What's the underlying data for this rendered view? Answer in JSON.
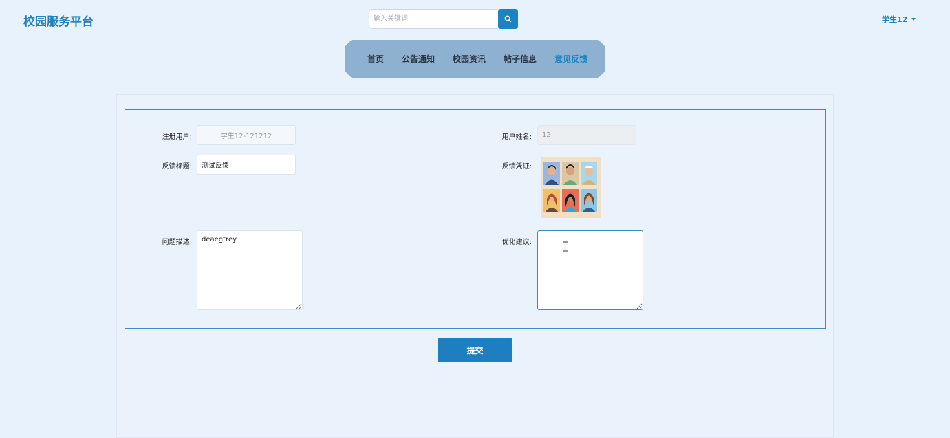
{
  "header": {
    "logo": "校园服务平台",
    "search": {
      "placeholder": "输入关键词",
      "icon": "search-icon"
    },
    "user": {
      "name": "学生12"
    }
  },
  "nav": {
    "items": [
      {
        "label": "首页",
        "active": false
      },
      {
        "label": "公告通知",
        "active": false
      },
      {
        "label": "校园资讯",
        "active": false
      },
      {
        "label": "帖子信息",
        "active": false
      },
      {
        "label": "意见反馈",
        "active": true
      }
    ]
  },
  "form": {
    "registered_user": {
      "label": "注册用户:",
      "value": "学生12-121212"
    },
    "user_name": {
      "label": "用户姓名:",
      "value": "12"
    },
    "feedback_title": {
      "label": "反馈标题:",
      "value": "测试反馈"
    },
    "feedback_evidence": {
      "label": "反馈凭证:"
    },
    "problem_desc": {
      "label": "问题描述:",
      "value": "deaegtrey"
    },
    "suggestion": {
      "label": "优化建议:",
      "value": ""
    },
    "submit_label": "提交"
  },
  "colors": {
    "accent": "#1e82c0",
    "nav_bg": "#8fb1d1",
    "page_bg": "#e8f2fc"
  }
}
